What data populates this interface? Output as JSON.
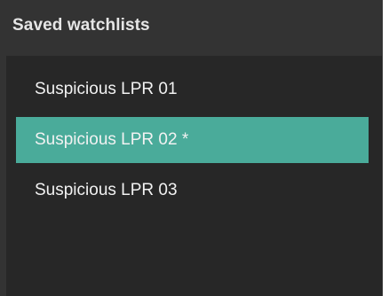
{
  "panel": {
    "title": "Saved watchlists"
  },
  "watchlists": {
    "items": [
      {
        "label": "Suspicious LPR 01",
        "selected": false
      },
      {
        "label": "Suspicious LPR 02 *",
        "selected": true
      },
      {
        "label": "Suspicious LPR 03",
        "selected": false
      }
    ],
    "selected_color": "#4aab9a"
  },
  "colors": {
    "panel_background": "#333333",
    "list_background": "#272727",
    "text": "#f2f2f2"
  }
}
